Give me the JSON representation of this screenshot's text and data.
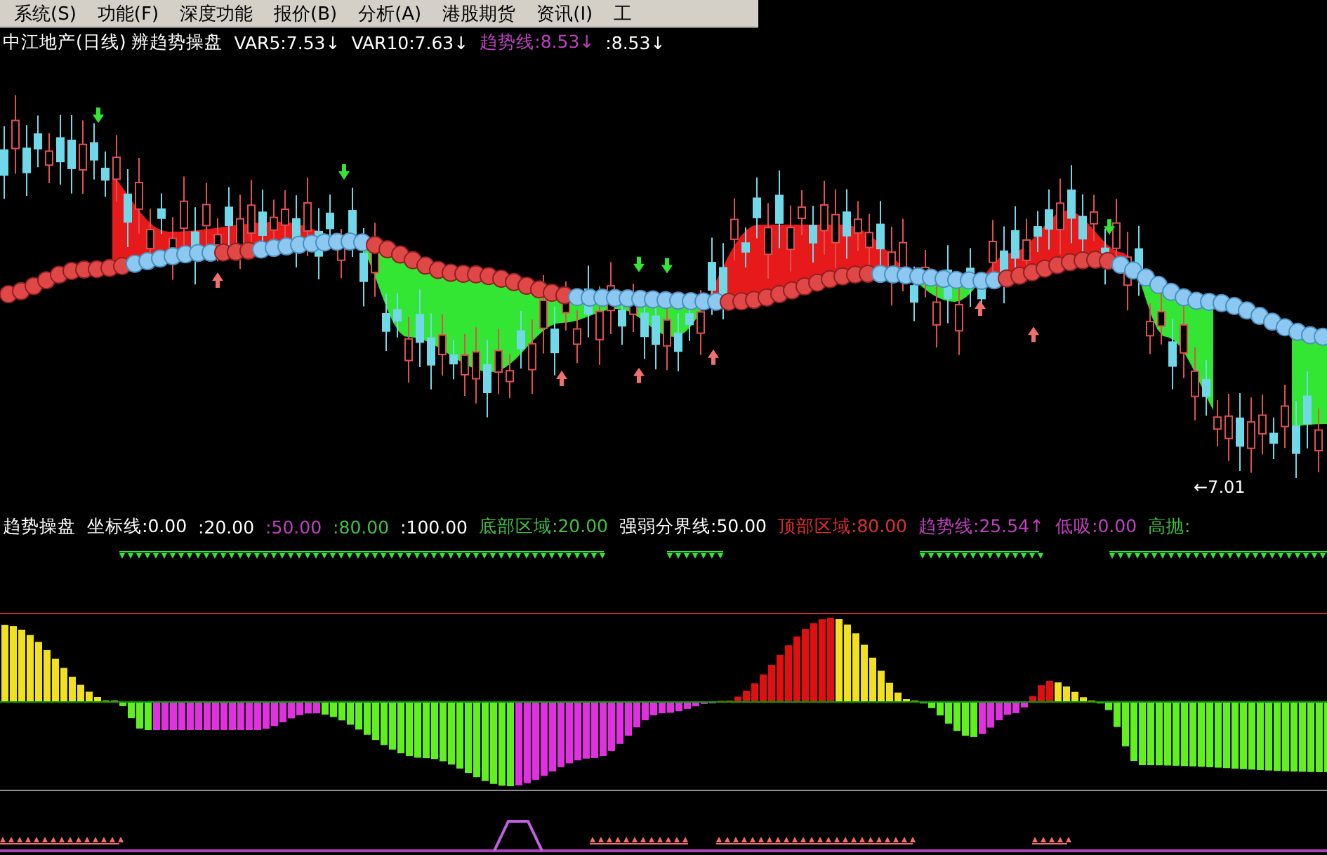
{
  "menu": [
    {
      "label": "系统(S)"
    },
    {
      "label": "功能(F)"
    },
    {
      "label": "深度功能"
    },
    {
      "label": "报价(B)"
    },
    {
      "label": "分析(A)"
    },
    {
      "label": "港股期货"
    },
    {
      "label": "资讯(I)"
    },
    {
      "label": "工"
    }
  ],
  "price_legend": [
    {
      "text": "中江地产(日线) 辨趋势操盘",
      "color": "#ffffff"
    },
    {
      "text": "VAR5:7.53↓",
      "color": "#ffffff"
    },
    {
      "text": "VAR10:7.63↓",
      "color": "#ffffff"
    },
    {
      "text": "趋势线:8.53↓",
      "color": "#c040c0"
    },
    {
      "text": ":8.53↓",
      "color": "#ffffff"
    }
  ],
  "price_label": "←7.01",
  "indicator_legend": [
    {
      "text": "趋势操盘",
      "color": "#ffffff"
    },
    {
      "text": "坐标线:0.00",
      "color": "#ffffff"
    },
    {
      "text": ":20.00",
      "color": "#ffffff"
    },
    {
      "text": ":50.00",
      "color": "#c040c0"
    },
    {
      "text": ":80.00",
      "color": "#40c040"
    },
    {
      "text": ":100.00",
      "color": "#ffffff"
    },
    {
      "text": "底部区域:20.00",
      "color": "#40c040"
    },
    {
      "text": "强弱分界线:50.00",
      "color": "#ffffff"
    },
    {
      "text": "顶部区域:80.00",
      "color": "#e03030"
    },
    {
      "text": "趋势线:25.54↑",
      "color": "#c040c0"
    },
    {
      "text": "低吸:0.00",
      "color": "#c040c0"
    },
    {
      "text": "高抛:",
      "color": "#40c040"
    }
  ]
}
